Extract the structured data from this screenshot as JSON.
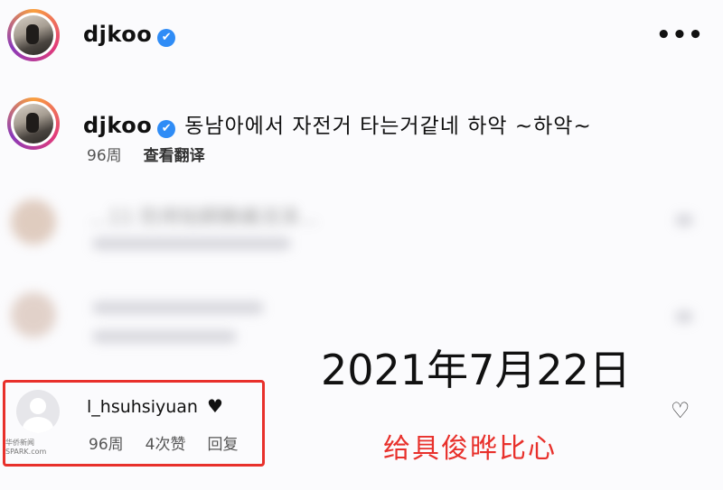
{
  "post_header": {
    "username": "djkoo",
    "verified_glyph": "✔",
    "more_glyph": "•••"
  },
  "caption_comment": {
    "username": "djkoo",
    "verified_glyph": "✔",
    "text": "동남아에서 자전거 타는거같네 하악 ~하악~",
    "age": "96周",
    "translate_label": "查看翻译"
  },
  "blurred_comments": [
    {
      "fragment": "…11 防用铂鋼鶻痛涚泽…"
    },
    {
      "fragment": ""
    }
  ],
  "highlighted_comment": {
    "username": "l_hsuhsiyuan",
    "heart_glyph": "♥",
    "age": "96周",
    "likes": "4次赞",
    "reply_label": "回复",
    "like_icon_glyph": "♡"
  },
  "overlay": {
    "date_text": "2021年7月22日",
    "caption_text": "给具俊晔比心",
    "highlight_color": "#e8302b"
  },
  "watermark": {
    "line1": "华侨新闻",
    "line2": "SPARK.com"
  },
  "icons": [
    "verified-icon",
    "more-icon",
    "heart-icon",
    "like-heart-icon",
    "default-avatar-icon"
  ]
}
